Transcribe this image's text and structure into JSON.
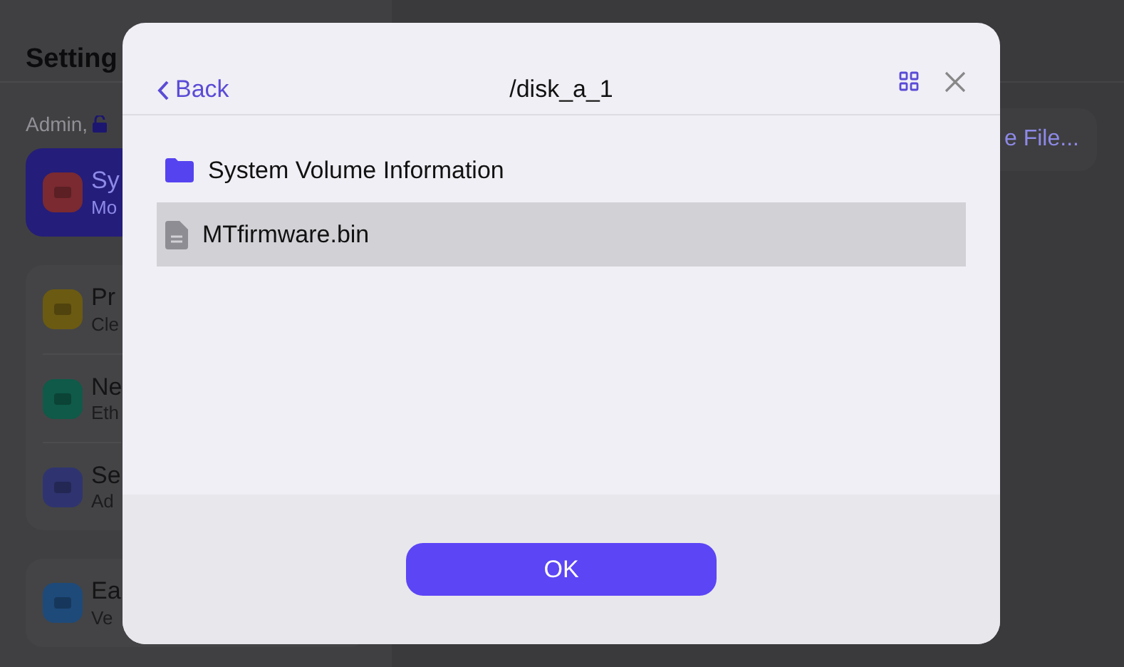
{
  "background": {
    "title": "Setting",
    "user": "Admin,",
    "groups": [
      {
        "items": [
          {
            "title": "Sy",
            "subtitle": "Mo",
            "selected": true,
            "color": "#7a2a30"
          }
        ]
      },
      {
        "items": [
          {
            "title": "Pr",
            "subtitle": "Cle",
            "selected": false,
            "color": "#6b5a12"
          },
          {
            "title": "Ne",
            "subtitle": "Eth",
            "selected": false,
            "color": "#0f5a48"
          },
          {
            "title": "Se",
            "subtitle": "Ad",
            "selected": false,
            "color": "#2f3470"
          }
        ]
      },
      {
        "items": [
          {
            "title": "Ea",
            "subtitle": "Ve",
            "selected": false,
            "color": "#1e4a7a"
          }
        ]
      }
    ],
    "action_button": "e File..."
  },
  "dialog": {
    "back": "Back",
    "path": "/disk_a_1",
    "items": [
      {
        "kind": "folder",
        "name": "System Volume Information",
        "selected": false
      },
      {
        "kind": "file",
        "name": "MTfirmware.bin",
        "selected": true
      }
    ],
    "ok": "OK"
  }
}
